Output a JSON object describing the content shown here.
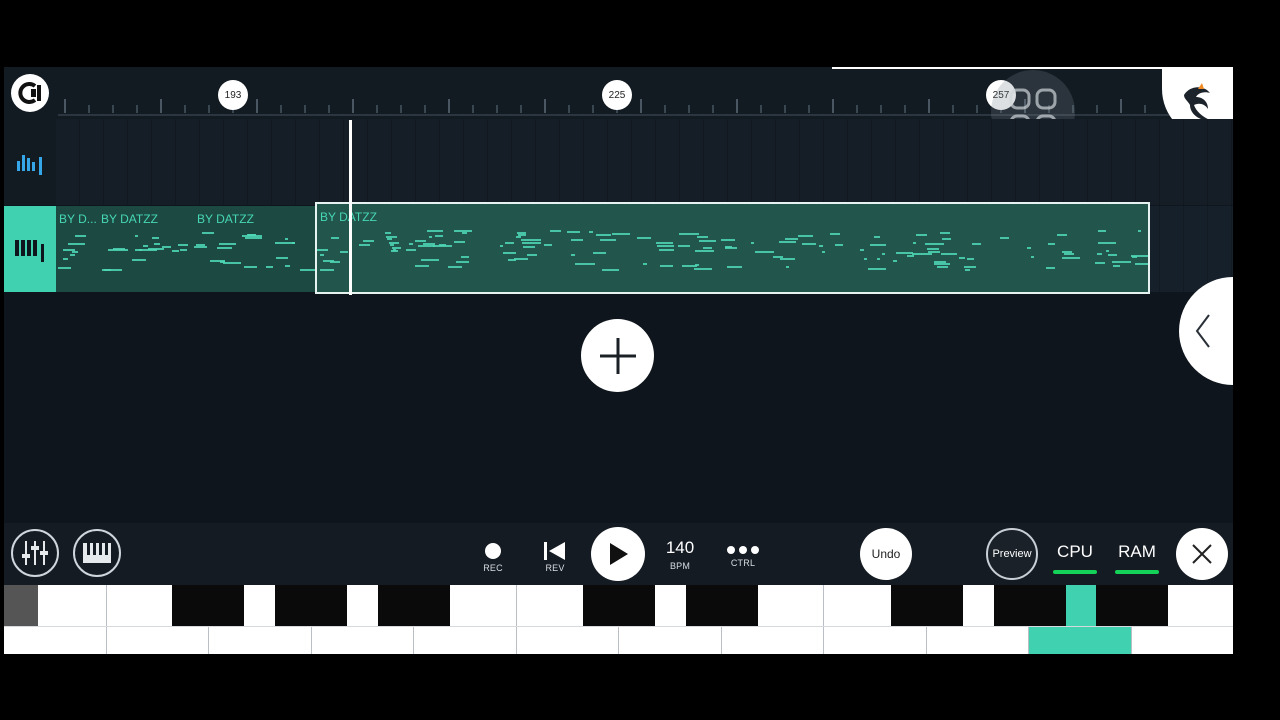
{
  "ruler": {
    "markers": [
      "193",
      "225",
      "257"
    ]
  },
  "tracks": [
    {
      "clips": [
        {
          "label": "BY D..."
        },
        {
          "label": "BY DATZZ"
        },
        {
          "label": "BY DATZZ"
        },
        {
          "label": "BY DATZZ",
          "selected": true
        }
      ]
    }
  ],
  "transport": {
    "rec_label": "REC",
    "rev_label": "REV",
    "bpm_value": "140",
    "bpm_label": "BPM",
    "ctrl_label": "CTRL",
    "undo_label": "Undo",
    "preview_label": "Preview",
    "cpu_label": "CPU",
    "ram_label": "RAM"
  },
  "colors": {
    "accent": "#3fd1b0",
    "meter": "#14d157",
    "background": "#0f151c"
  },
  "icons": {
    "logo": "fl-logo-icon",
    "loop": "loop-icon",
    "mixer": "mixer-icon",
    "piano": "piano-icon",
    "add": "plus-icon",
    "close": "close-icon"
  }
}
